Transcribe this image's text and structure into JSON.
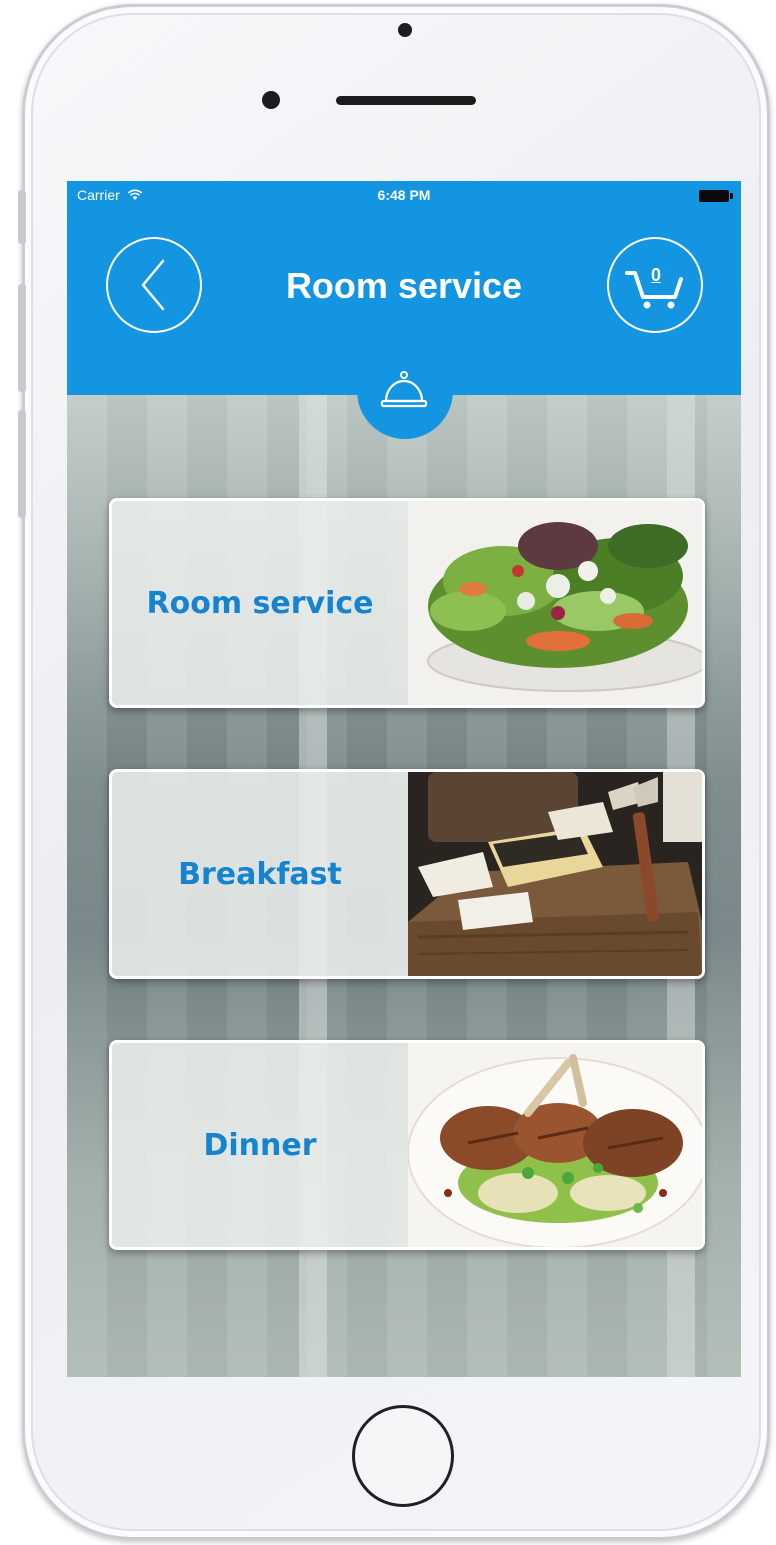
{
  "status_bar": {
    "carrier": "Carrier",
    "time": "6:48 PM"
  },
  "nav": {
    "title": "Room service",
    "back_icon": "chevron-left-icon",
    "cart_icon": "shopping-cart-icon",
    "cart_count": "0",
    "section_icon": "service-bell-icon"
  },
  "menu": {
    "items": [
      {
        "label": "Room service",
        "image": "salad-plate"
      },
      {
        "label": "Breakfast",
        "image": "cheese-board"
      },
      {
        "label": "Dinner",
        "image": "lamb-chops-plate"
      }
    ]
  },
  "colors": {
    "primary": "#1395e1",
    "label": "#1583cf",
    "card_border": "#ffffff"
  }
}
